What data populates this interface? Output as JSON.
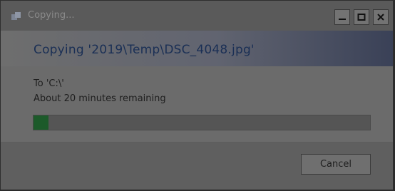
{
  "window": {
    "title": "Copying...",
    "controls": {
      "minimize_icon": "minimize-icon",
      "maximize_icon": "maximize-icon",
      "close_icon": "close-icon"
    }
  },
  "copy": {
    "heading": "Copying '2019\\Temp\\DSC_4048.jpg'",
    "destination": "To 'C:\\'",
    "time_remaining": "About 20 minutes remaining",
    "progress_fraction": 0.045
  },
  "footer": {
    "cancel_label": "Cancel"
  },
  "colors": {
    "progress_fill": "#1c5a2a",
    "title_text": "#1a2f55"
  }
}
